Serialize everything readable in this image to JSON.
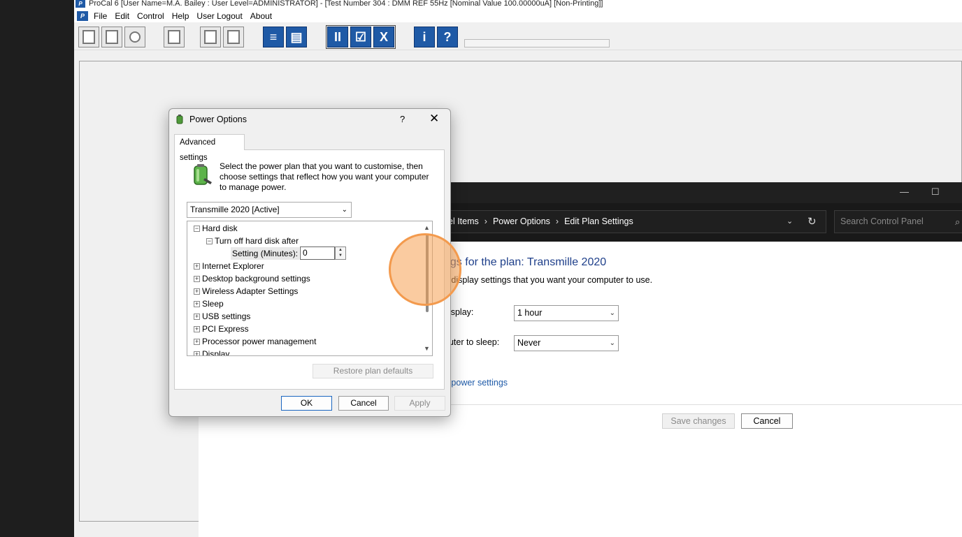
{
  "procal": {
    "title": "ProCal 6 [User Name=M.A. Bailey : User Level=ADMINISTRATOR] - [Test Number 304 : DMM REF 55Hz [Nominal Value 100.00000uA] [Non-Printing]]",
    "app_icon": "P",
    "menu": [
      "File",
      "Edit",
      "Control",
      "Help",
      "User Logout",
      "About"
    ],
    "toolbar_pause_glyph": "II",
    "toolbar_close_glyph": "X",
    "toolbar_info_glyph": "i",
    "toolbar_help_glyph": "?"
  },
  "control_panel": {
    "breadcrumb": [
      "el Items",
      "Power Options",
      "Edit Plan Settings"
    ],
    "breadcrumb_sep": "›",
    "search_placeholder": "Search Control Panel",
    "heading": "ngs for the plan: Transmille 2020",
    "subtext": "d display settings that you want your computer to use.",
    "display_label": "display:",
    "display_value": "1 hour",
    "sleep_label": "puter to sleep:",
    "sleep_value": "Never",
    "advanced_link": "d power settings",
    "save_label": "Save changes",
    "cancel_label": "Cancel"
  },
  "dialog": {
    "title": "Power Options",
    "help": "?",
    "close": "✕",
    "tab": "Advanced settings",
    "intro": "Select the power plan that you want to customise, then choose settings that reflect how you want your computer to manage power.",
    "plan": "Transmille 2020 [Active]",
    "tree": {
      "hard_disk": "Hard disk",
      "turn_off": "Turn off hard disk after",
      "setting_label": "Setting (Minutes):",
      "setting_value": "0",
      "items": [
        "Internet Explorer",
        "Desktop background settings",
        "Wireless Adapter Settings",
        "Sleep",
        "USB settings",
        "PCI Express",
        "Processor power management",
        "Display"
      ]
    },
    "restore": "Restore plan defaults",
    "ok": "OK",
    "cancel": "Cancel",
    "apply": "Apply"
  },
  "colors": {
    "accent_blue": "#1f5aa6",
    "click_highlight": "#f39a4d",
    "link": "#1e5aa8"
  }
}
